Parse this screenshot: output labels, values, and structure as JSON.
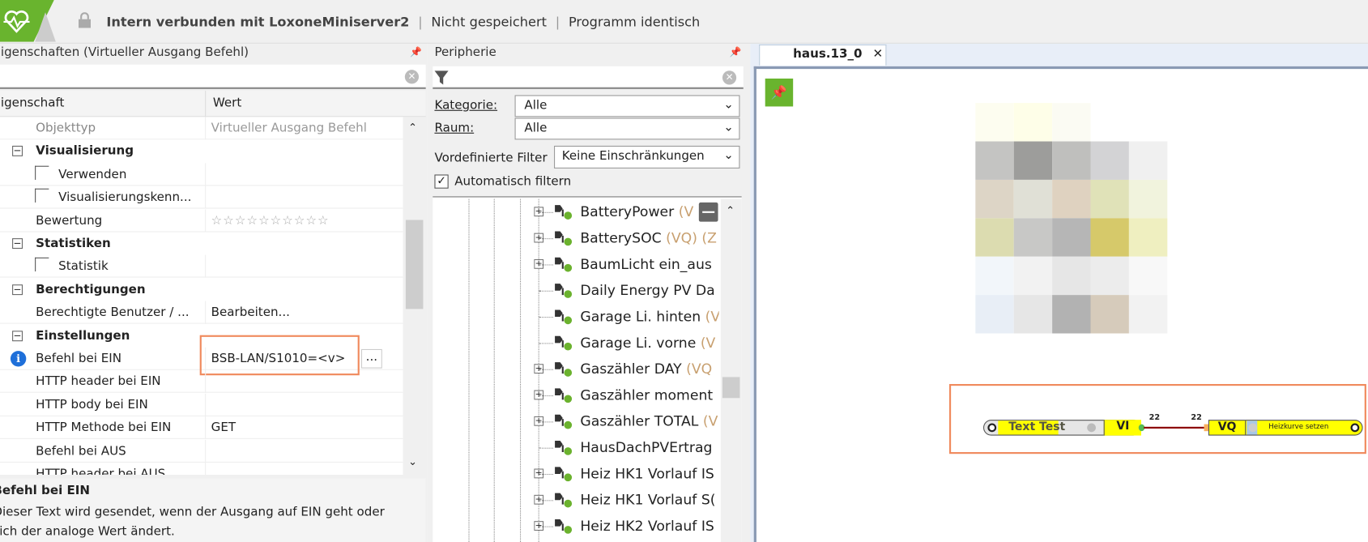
{
  "topbar": {
    "connection": "Intern verbunden mit LoxoneMiniserver2",
    "save_state": "Nicht gespeichert",
    "program_state": "Programm identisch",
    "separator": "|"
  },
  "properties": {
    "title": "Eigenschaften (Virtueller Ausgang Befehl)",
    "col_property": "Eigenschaft",
    "col_value": "Wert",
    "rows": [
      {
        "label": "Objekttyp",
        "value": "Virtueller Ausgang Befehl",
        "type": "readonly"
      },
      {
        "label": "Visualisierung",
        "type": "group"
      },
      {
        "label": "Verwenden",
        "type": "checkbox"
      },
      {
        "label": "Visualisierungskenn...",
        "type": "checkbox"
      },
      {
        "label": "Bewertung",
        "value": "☆☆☆☆☆☆☆☆☆☆",
        "type": "rating"
      },
      {
        "label": "Statistiken",
        "type": "group"
      },
      {
        "label": "Statistik",
        "type": "checkbox"
      },
      {
        "label": "Berechtigungen",
        "type": "group"
      },
      {
        "label": "Berechtigte Benutzer / ...",
        "value": "Bearbeiten...",
        "type": "text"
      },
      {
        "label": "Einstellungen",
        "type": "group"
      },
      {
        "label": "Befehl bei EIN",
        "value": "BSB-LAN/S1010=<v>",
        "type": "highlight"
      },
      {
        "label": "HTTP header bei EIN",
        "value": "",
        "type": "text"
      },
      {
        "label": "HTTP body bei EIN",
        "value": "",
        "type": "text"
      },
      {
        "label": "HTTP Methode bei EIN",
        "value": "GET",
        "type": "text"
      },
      {
        "label": "Befehl bei AUS",
        "value": "",
        "type": "text"
      },
      {
        "label": "HTTP header bei AUS",
        "value": "",
        "type": "text"
      }
    ],
    "ellipsis_button": "...",
    "help_title": "Befehl bei EIN",
    "help_text_1": "Dieser Text wird gesendet, wenn der Ausgang auf EIN geht oder",
    "help_text_2": "sich der analoge Wert ändert."
  },
  "periphery": {
    "title": "Peripherie",
    "kategorie_label": "Kategorie:",
    "kategorie_value": "Alle",
    "raum_label": "Raum:",
    "raum_value": "Alle",
    "filter_label": "Vordefinierte Filter",
    "filter_value": "Keine Einschränkungen",
    "auto_filter_label": "Automatisch filtern",
    "auto_filter_checked": true,
    "items": [
      {
        "name": "BatteryPower",
        "suffix": " (V",
        "expandable": true
      },
      {
        "name": "BatterySOC",
        "suffix": " (VQ) (Z",
        "expandable": true
      },
      {
        "name": "BaumLicht ein_aus",
        "suffix": "",
        "expandable": true
      },
      {
        "name": "Daily Energy PV Da",
        "suffix": "",
        "expandable": false
      },
      {
        "name": "Garage Li. hinten",
        "suffix": " (V",
        "expandable": false
      },
      {
        "name": "Garage Li. vorne",
        "suffix": " (V",
        "expandable": false
      },
      {
        "name": "Gaszähler DAY",
        "suffix": " (VQ",
        "expandable": true
      },
      {
        "name": "Gaszähler moment",
        "suffix": "",
        "expandable": true
      },
      {
        "name": "Gaszähler TOTAL",
        "suffix": " (V",
        "expandable": true
      },
      {
        "name": "HausDachPVErtrag",
        "suffix": "",
        "expandable": false
      },
      {
        "name": "Heiz HK1 Vorlauf IS",
        "suffix": "",
        "expandable": true
      },
      {
        "name": "Heiz HK1 Vorlauf S(",
        "suffix": "",
        "expandable": true
      },
      {
        "name": "Heiz HK2 Vorlauf IS",
        "suffix": "",
        "expandable": true
      }
    ]
  },
  "editor": {
    "tab_label": "haus.13_0",
    "tab_close": "✕",
    "block_input_label": "Text Test",
    "block_input_port": "VI",
    "block_output_port": "VQ",
    "block_output_label": "Heizkurve setzen",
    "wire_label_left": "22",
    "wire_label_right": "22"
  },
  "colors": {
    "accent_green": "#69b42e",
    "highlight": "#f08a5d",
    "block_yellow": "#ffff00",
    "wire": "#8b0000"
  }
}
